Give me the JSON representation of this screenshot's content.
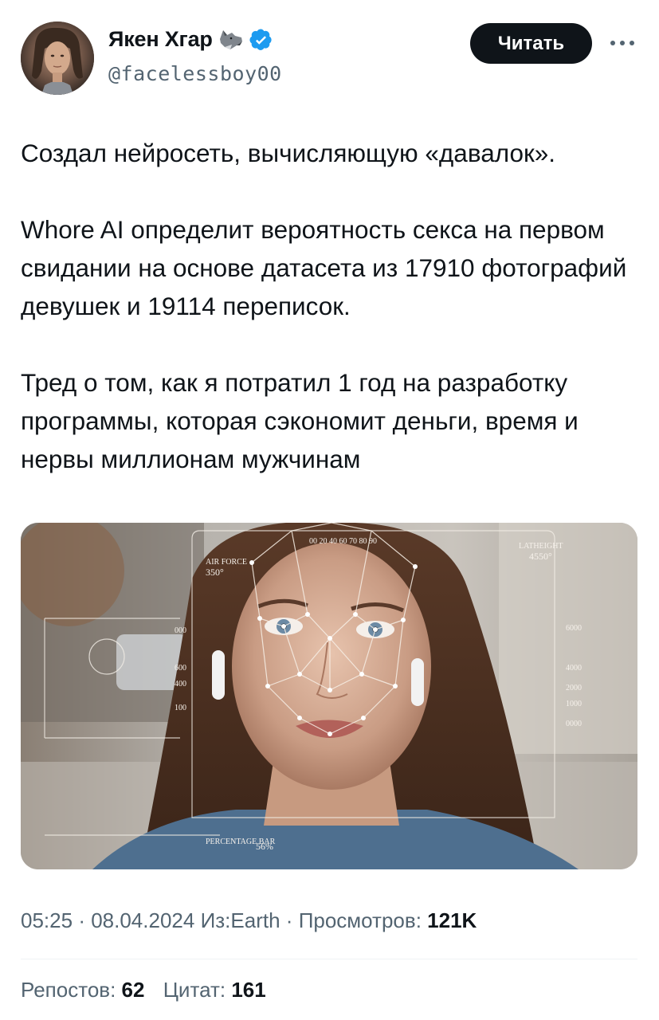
{
  "author": {
    "name": "Якен Хгар",
    "handle": "@facelessboy00",
    "emoji_icon": "wolf-emoji",
    "verified_color": "#1d9bf0"
  },
  "actions": {
    "follow_label": "Читать",
    "more_icon": "more-horizontal-icon"
  },
  "tweet": {
    "paragraph1": "Создал нейросеть, вычисляющую «давалок».",
    "paragraph2": "Whore AI определит вероятность секса на первом свидании на основе датасета из 17910 фотографий девушек и 19114 переписок.",
    "paragraph3": "Тред о том, как я потратил 1 год на разработку программы, которая сэкономит деньги, время и нервы миллионам мужчинам"
  },
  "meta": {
    "time": "05:25",
    "date": "08.04.2024",
    "location": "Из:Earth",
    "views_label": "Просмотров:",
    "views_value": "121K"
  },
  "stats": {
    "reposts_label": "Репостов:",
    "reposts_value": "62",
    "quotes_label": "Цитат:",
    "quotes_value": "161"
  },
  "hud": {
    "altitude_label": "AIR FORCE",
    "altitude_value": "350°",
    "latitude_label": "LATHEIGHT",
    "latitude_value": "4550°",
    "percentage_label": "PERCENTAGE BAR",
    "percentage_value": "56%",
    "scale_top": "00 20 40 60 70 80 90",
    "scale_right": [
      "6000",
      "4000",
      "2000",
      "1000",
      "0000"
    ],
    "scale_left": [
      "000",
      "600",
      "400",
      "100"
    ]
  },
  "colors": {
    "text": "#0f1419",
    "secondary": "#536471",
    "button_bg": "#0f1419"
  }
}
